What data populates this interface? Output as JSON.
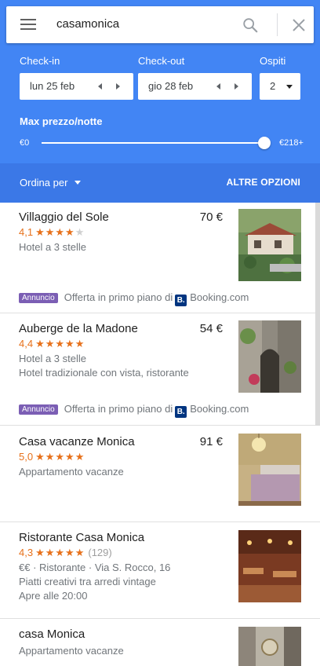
{
  "search": {
    "query": "casamonica"
  },
  "filters": {
    "checkin_label": "Check-in",
    "checkin_value": "lun 25 feb",
    "checkout_label": "Check-out",
    "checkout_value": "gio 28 feb",
    "guests_label": "Ospiti",
    "guests_value": "2",
    "price_label": "Max prezzo/notte",
    "price_min": "€0",
    "price_max": "€218+",
    "price_level": 1.0
  },
  "sortbar": {
    "sort_label": "Ordina per",
    "more_label": "ALTRE OPZIONI"
  },
  "results": [
    {
      "name": "Villaggio del Sole",
      "price": "70 €",
      "rating": "4,1",
      "stars": "★★★★",
      "stars_empty": "★",
      "type": "Hotel a 3 stelle",
      "ad_badge": "Annuncio",
      "ad_text": "Offerta in primo piano di",
      "ad_logo": "B.",
      "ad_provider": "Booking.com"
    },
    {
      "name": "Auberge de la Madone",
      "price": "54 €",
      "rating": "4,4",
      "stars": "★★★★★",
      "type": "Hotel a 3 stelle",
      "desc": "Hotel tradizionale con vista, ristorante",
      "ad_badge": "Annuncio",
      "ad_text": "Offerta in primo piano di",
      "ad_logo": "B.",
      "ad_provider": "Booking.com"
    },
    {
      "name": "Casa vacanze Monica",
      "price": "91 €",
      "rating": "5,0",
      "stars": "★★★★★",
      "type": "Appartamento vacanze"
    },
    {
      "name": "Ristorante Casa Monica",
      "rating": "4,3",
      "stars": "★★★★★",
      "reviews": "(129)",
      "meta": "€€ · Ristorante · Via S. Rocco, 16",
      "desc": "Piatti creativi tra arredi vintage",
      "hours": "Apre alle 20:00"
    },
    {
      "name": "casa Monica",
      "type": "Appartamento vacanze"
    }
  ],
  "colors": {
    "header": "#4285f4",
    "sortbar": "#3b78e7",
    "rating": "#e7711b",
    "ad_badge": "#7b5eb4",
    "booking": "#003580"
  },
  "icons": {
    "menu": "menu-icon",
    "search": "search-icon",
    "close": "close-icon"
  }
}
